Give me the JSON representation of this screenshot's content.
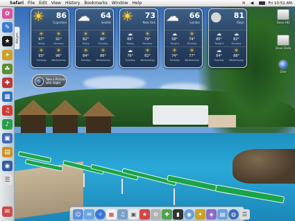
{
  "menubar": {
    "apple_icon": "apple-icon",
    "app_name": "Safari",
    "menus": [
      "File",
      "Edit",
      "View",
      "History",
      "Bookmarks",
      "Window",
      "Help"
    ],
    "clock": "Fri 10:51 AM"
  },
  "widgets_tab": {
    "label": "Widgets"
  },
  "weather": [
    {
      "city": "Cupertino",
      "temp": "86",
      "icon": "sun-icon",
      "forecast": [
        {
          "hi": "97°",
          "lo": "",
          "day": "Today",
          "icon": "sun-icon"
        },
        {
          "hi": "91°",
          "lo": "",
          "day": "Monday",
          "icon": "sun-icon"
        },
        {
          "hi": "93°",
          "lo": "",
          "day": "Tuesday",
          "icon": "sun-icon"
        },
        {
          "hi": "96°",
          "lo": "",
          "day": "Wednesday",
          "icon": "sun-icon"
        }
      ]
    },
    {
      "city": "Seattle",
      "temp": "64",
      "icon": "cloud-icon",
      "forecast": [
        {
          "hi": "82°",
          "lo": "",
          "day": "Today",
          "icon": "sun-icon"
        },
        {
          "hi": "80°",
          "lo": "",
          "day": "Monday",
          "icon": "sun-icon"
        },
        {
          "hi": "84°",
          "lo": "",
          "day": "Tuesday",
          "icon": "sun-icon"
        },
        {
          "hi": "86°",
          "lo": "",
          "day": "Wednesday",
          "icon": "sun-icon"
        }
      ]
    },
    {
      "city": "New York",
      "temp": "73",
      "icon": "sun-icon",
      "forecast": [
        {
          "hi": "86°",
          "lo": "",
          "day": "Today",
          "icon": "cloud-icon"
        },
        {
          "hi": "79°",
          "lo": "",
          "day": "Monday",
          "icon": "sun-icon"
        },
        {
          "hi": "76°",
          "lo": "",
          "day": "Tuesday",
          "icon": "cloud-icon"
        },
        {
          "hi": "82°",
          "lo": "",
          "day": "Wednesday",
          "icon": "sun-icon"
        }
      ]
    },
    {
      "city": "London",
      "temp": "66",
      "icon": "cloud-icon",
      "forecast": [
        {
          "hi": "58°",
          "lo": "",
          "day": "Tonight",
          "icon": "cloud-icon"
        },
        {
          "hi": "74°",
          "lo": "",
          "day": "Monday",
          "icon": "sun-icon"
        },
        {
          "hi": "74°",
          "lo": "",
          "day": "Tuesday",
          "icon": "sun-icon"
        },
        {
          "hi": "77°",
          "lo": "",
          "day": "Wednesday",
          "icon": "sun-icon"
        }
      ]
    },
    {
      "city": "Tokyo",
      "temp": "81",
      "icon": "moon-icon",
      "forecast": [
        {
          "hi": "80°",
          "lo": "",
          "day": "Tonight",
          "icon": "cloud-icon"
        },
        {
          "hi": "82°",
          "lo": "",
          "day": "Monday",
          "icon": "cloud-icon"
        },
        {
          "hi": "84°",
          "lo": "",
          "day": "Tuesday",
          "icon": "cloud-icon"
        },
        {
          "hi": "88°",
          "lo": "",
          "day": "Wednesday",
          "icon": "sun-icon"
        }
      ]
    }
  ],
  "picture_widget": {
    "line1": "Take a Picture",
    "line2": "with iSight"
  },
  "desktop_icons": [
    {
      "label": "Dave HD",
      "icon": "hard-drive-icon"
    },
    {
      "label": "Dave Data",
      "icon": "hard-drive-icon"
    },
    {
      "label": "Disk",
      "icon": "disk-icon"
    }
  ],
  "left_dock_icons": [
    "finder-icon",
    "compass-icon",
    "star-icon",
    "mail-icon",
    "note-icon",
    "folder-icon",
    "calendar-icon",
    "music-icon",
    "photo-icon",
    "film-icon",
    "book-icon"
  ],
  "bottom_dock_icons": [
    "finder-icon",
    "mail-icon",
    "safari-icon",
    "ical-icon",
    "itunes-icon",
    "iphoto-icon",
    "imovie-icon",
    "preferences-icon",
    "appstore-icon",
    "terminal-icon",
    "chat-icon",
    "maps-icon",
    "widget-icon",
    "folder-icon",
    "globe-icon",
    "documents-icon"
  ],
  "colors": {
    "weather_panel": "#2a4466",
    "dock": "#dce4ec",
    "pool": "#2aa9d8"
  }
}
